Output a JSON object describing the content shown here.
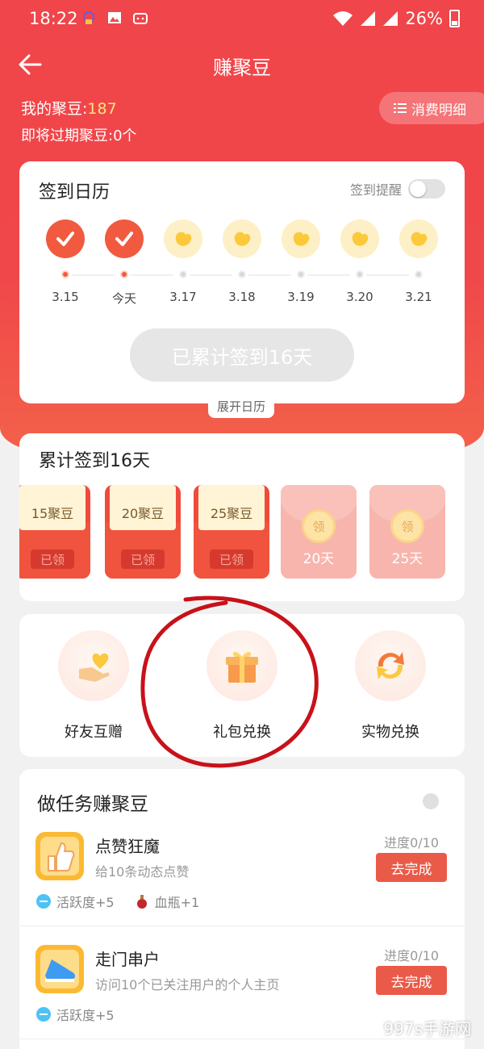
{
  "status_bar": {
    "time": "18:22",
    "battery": "26%"
  },
  "nav": {
    "title": "赚聚豆"
  },
  "header": {
    "beans_label": "我的聚豆:",
    "beans_value": "187",
    "expire_text": "即将过期聚豆:0个",
    "detail_label": "消费明细"
  },
  "calendar": {
    "title": "签到日历",
    "remind_label": "签到提醒",
    "days": [
      {
        "label": "3.15",
        "done": true
      },
      {
        "label": "今天",
        "done": true
      },
      {
        "label": "3.17",
        "done": false
      },
      {
        "label": "3.18",
        "done": false
      },
      {
        "label": "3.19",
        "done": false
      },
      {
        "label": "3.20",
        "done": false
      },
      {
        "label": "3.21",
        "done": false
      }
    ],
    "signed_button": "已累计签到16天",
    "expand_label": "展开日历"
  },
  "cumulative": {
    "title": "累计签到16天",
    "rewards": [
      {
        "text": "15聚豆",
        "status": "已领"
      },
      {
        "text": "20聚豆",
        "status": "已领"
      },
      {
        "text": "25聚豆",
        "status": "已领"
      },
      {
        "coin": "领",
        "days": "20天"
      },
      {
        "coin": "领",
        "days": "25天"
      }
    ]
  },
  "actions": [
    {
      "label": "好友互赠",
      "icon": "gift-hand-icon"
    },
    {
      "label": "礼包兑换",
      "icon": "gift-box-icon"
    },
    {
      "label": "实物兑换",
      "icon": "exchange-icon"
    }
  ],
  "tasks": {
    "title": "做任务赚聚豆",
    "items": [
      {
        "name": "点赞狂魔",
        "desc": "给10条动态点赞",
        "progress": "进度0/10",
        "button": "去完成",
        "rewards": [
          "活跃度+5",
          "血瓶+1"
        ]
      },
      {
        "name": "走门串户",
        "desc": "访问10个已关注用户的个人主页",
        "progress": "进度0/10",
        "button": "去完成",
        "rewards": [
          "活跃度+5"
        ]
      }
    ]
  },
  "watermark": "997s手游网",
  "colors": {
    "brand_red": "#f0454a",
    "accent_orange": "#f15a3f",
    "bean_yellow": "#ffe37a"
  }
}
